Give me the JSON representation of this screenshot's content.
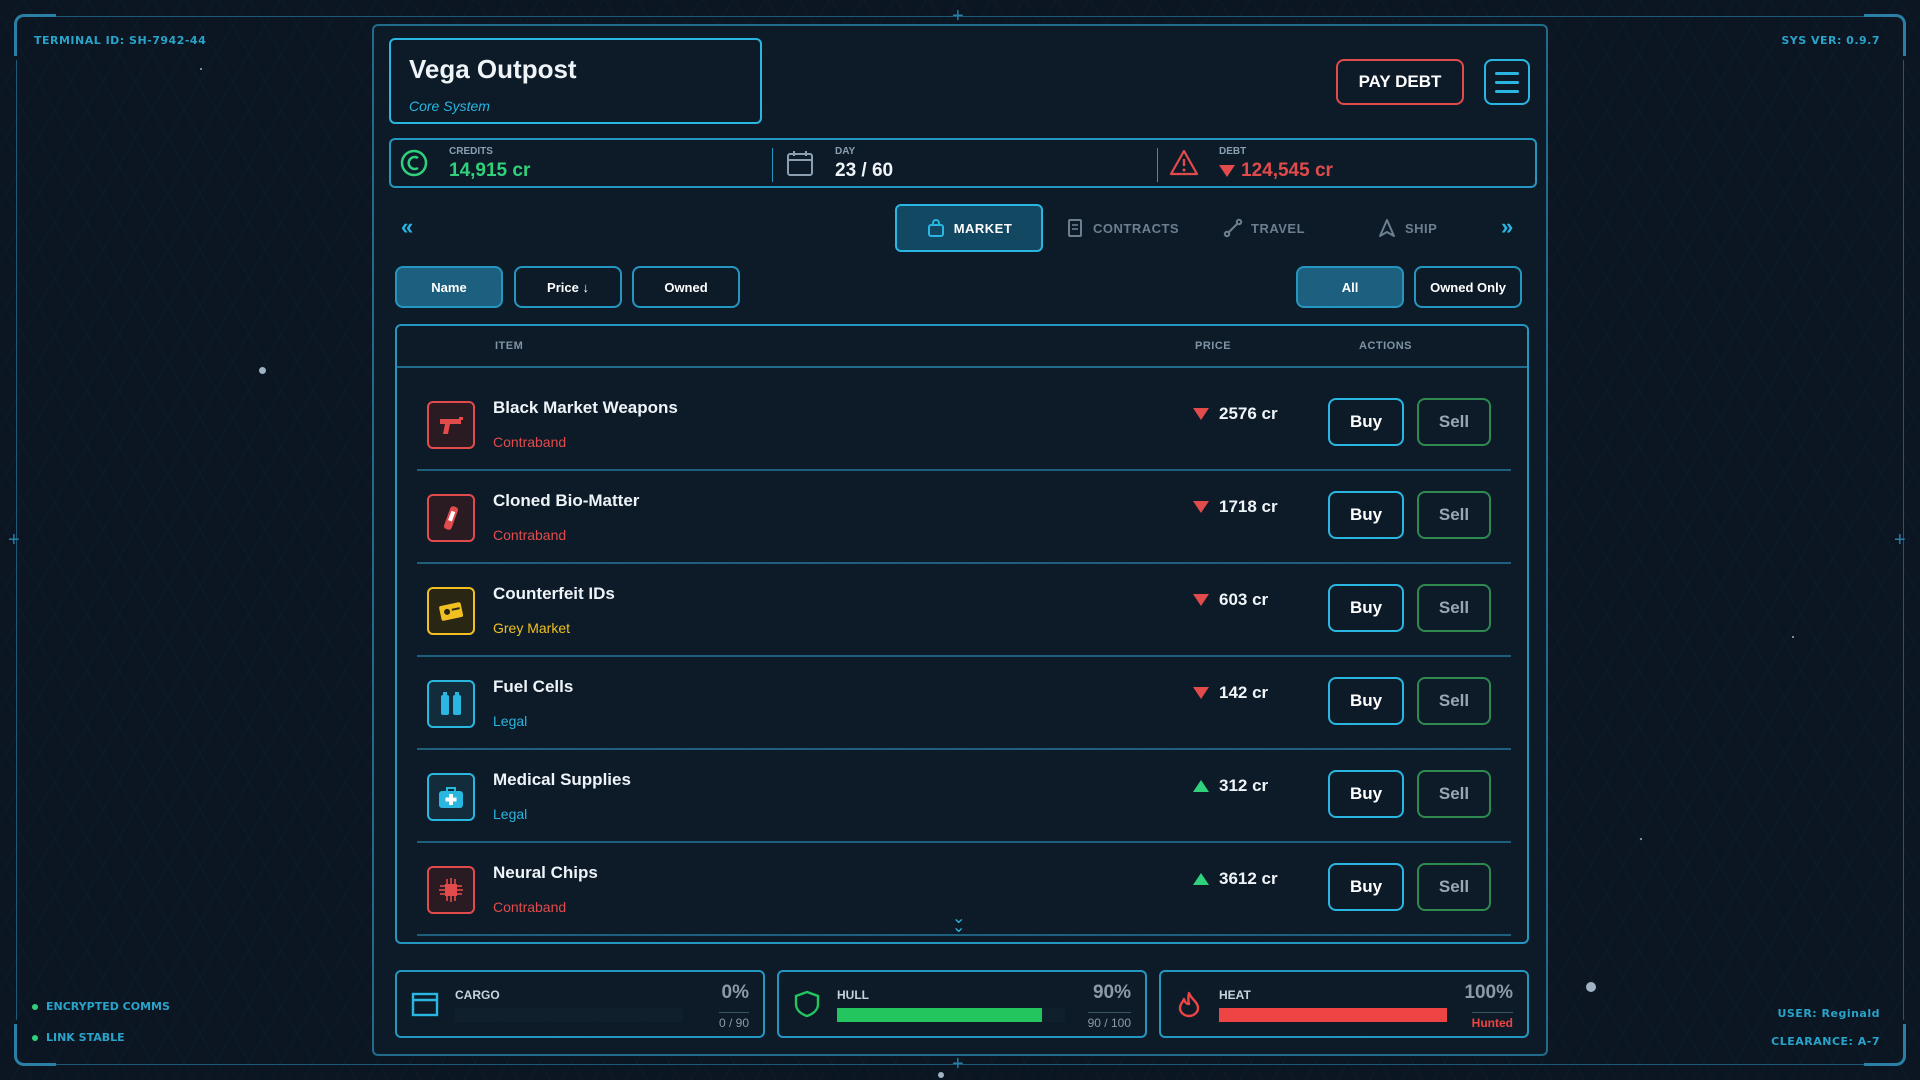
{
  "hud": {
    "terminal_id": "TERMINAL ID: SH-7942-44",
    "sys_ver": "SYS VER: 0.9.7",
    "status": [
      "ENCRYPTED COMMS",
      "LINK STABLE"
    ],
    "user": "USER: Reginald",
    "clearance": "CLEARANCE: A-7"
  },
  "location": {
    "name": "Vega Outpost",
    "system": "Core System"
  },
  "header": {
    "pay_debt_label": "PAY DEBT"
  },
  "stats": {
    "credits": {
      "label": "CREDITS",
      "value": "14,915 cr",
      "icon": "credits-icon"
    },
    "day": {
      "label": "DAY",
      "value": "23 / 60",
      "icon": "calendar-icon"
    },
    "debt": {
      "label": "DEBT",
      "value": "124,545 cr",
      "icon": "warning-icon"
    }
  },
  "tabs": [
    {
      "label": "MARKET",
      "icon": "bag-icon",
      "active": true
    },
    {
      "label": "CONTRACTS",
      "icon": "document-icon",
      "active": false
    },
    {
      "label": "TRAVEL",
      "icon": "route-icon",
      "active": false
    },
    {
      "label": "SHIP",
      "icon": "ship-icon",
      "active": false
    }
  ],
  "sort": {
    "name": "Name",
    "price": "Price ↓",
    "owned": "Owned"
  },
  "filter": {
    "all": "All",
    "owned_only": "Owned Only"
  },
  "table": {
    "headers": {
      "item": "ITEM",
      "price": "PRICE",
      "actions": "ACTIONS"
    },
    "buy_label": "Buy",
    "sell_label": "Sell",
    "rows": [
      {
        "name": "Black Market Weapons",
        "category": "Contraband",
        "price": "2576 cr",
        "trend": "down",
        "icon": "gun-icon"
      },
      {
        "name": "Cloned Bio-Matter",
        "category": "Contraband",
        "price": "1718 cr",
        "trend": "down",
        "icon": "vial-icon"
      },
      {
        "name": "Counterfeit IDs",
        "category": "Grey Market",
        "price": "603 cr",
        "trend": "down",
        "icon": "id-card-icon"
      },
      {
        "name": "Fuel Cells",
        "category": "Legal",
        "price": "142 cr",
        "trend": "down",
        "icon": "fuel-cell-icon"
      },
      {
        "name": "Medical Supplies",
        "category": "Legal",
        "price": "312 cr",
        "trend": "up",
        "icon": "medkit-icon"
      },
      {
        "name": "Neural Chips",
        "category": "Contraband",
        "price": "3612 cr",
        "trend": "up",
        "icon": "chip-icon"
      }
    ]
  },
  "category_colors": {
    "Contraband": "#e24b4b",
    "Grey Market": "#f0c020",
    "Legal": "#29b6e0"
  },
  "gauges": {
    "cargo": {
      "label": "CARGO",
      "pct": "0%",
      "sub": "0 / 90",
      "fill": 0,
      "color": "#2fd27a",
      "icon": "cargo-icon"
    },
    "hull": {
      "label": "HULL",
      "pct": "90%",
      "sub": "90 / 100",
      "fill": 0.9,
      "color": "#22c55e",
      "icon": "shield-icon"
    },
    "heat": {
      "label": "HEAT",
      "pct": "100%",
      "sub": "Hunted",
      "fill": 1.0,
      "color": "#ef4444",
      "icon": "flame-icon"
    }
  }
}
